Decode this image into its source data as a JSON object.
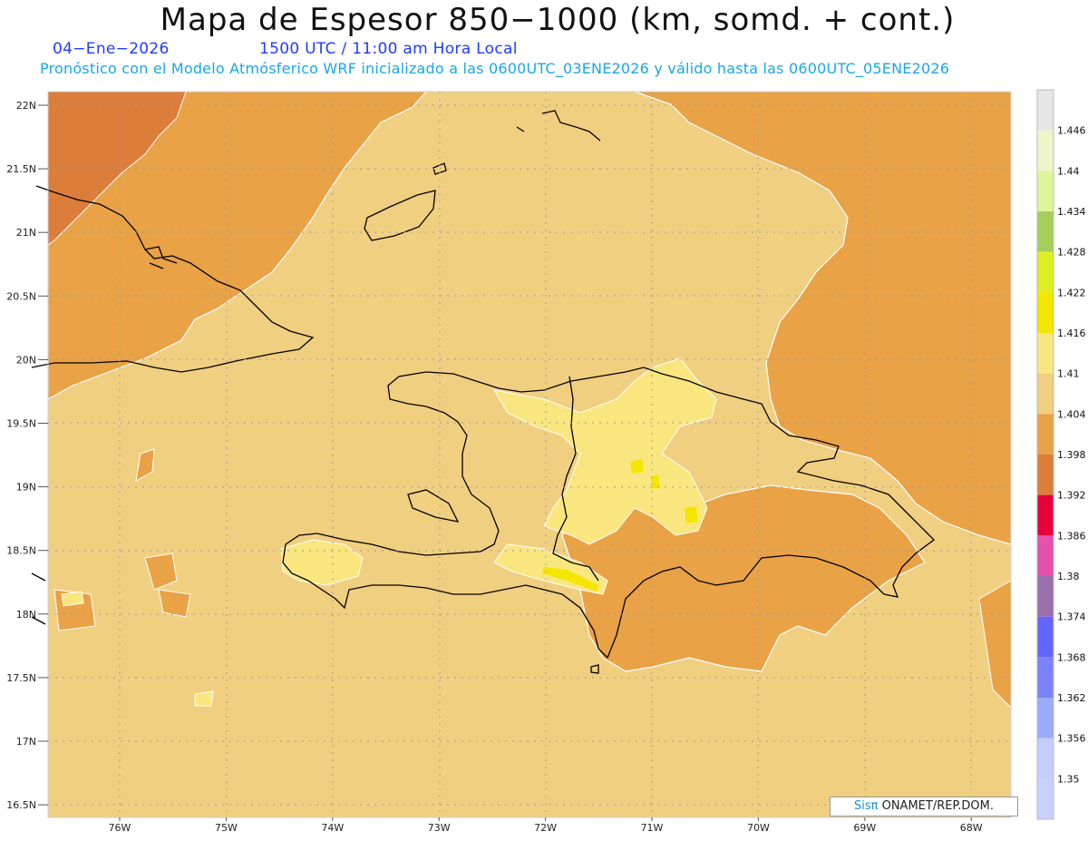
{
  "header": {
    "title": "Mapa de Espesor 850−1000 (km, somd. + cont.)",
    "date": "04−Ene−2026",
    "time": "1500 UTC / 11:00 am Hora Local",
    "description": "Pronóstico con el Modelo Atmósferico WRF inicializado a las 0600UTC_03ENE2026 y válido hasta las  0600UTC_05ENE2026"
  },
  "axes": {
    "lat_labels": [
      "22N",
      "21.5N",
      "21N",
      "20.5N",
      "20N",
      "19.5N",
      "19N",
      "18.5N",
      "18N",
      "17.5N",
      "17N",
      "16.5N"
    ],
    "lon_labels": [
      "76W",
      "75W",
      "74W",
      "73W",
      "72W",
      "71W",
      "70W",
      "69W",
      "68W"
    ]
  },
  "legend": {
    "values": [
      "1.446",
      "1.44",
      "1.434",
      "1.428",
      "1.422",
      "1.416",
      "1.41",
      "1.404",
      "1.398",
      "1.392",
      "1.386",
      "1.38",
      "1.374",
      "1.368",
      "1.362",
      "1.356",
      "1.35"
    ],
    "colors": [
      "#e6e6e6",
      "#eef5c8",
      "#def59a",
      "#a6cd5c",
      "#dfee22",
      "#f5e600",
      "#f9e67f",
      "#f1cf81",
      "#e9a246",
      "#dc7d3a",
      "#e8003a",
      "#e54fae",
      "#9a71ad",
      "#6464ff",
      "#7b82ff",
      "#99acff",
      "#c3cdff"
    ]
  },
  "credit": {
    "brand": "Sis",
    "pi": "π",
    "text": " ONAMET/REP.DOM."
  },
  "colors": {
    "ocean_base": "#f1cf81",
    "warm_band": "#e9a246",
    "hot_band": "#dc7d3a",
    "high_band": "#f9e67f",
    "peak_band": "#f5e600",
    "coastline": "#000000"
  }
}
